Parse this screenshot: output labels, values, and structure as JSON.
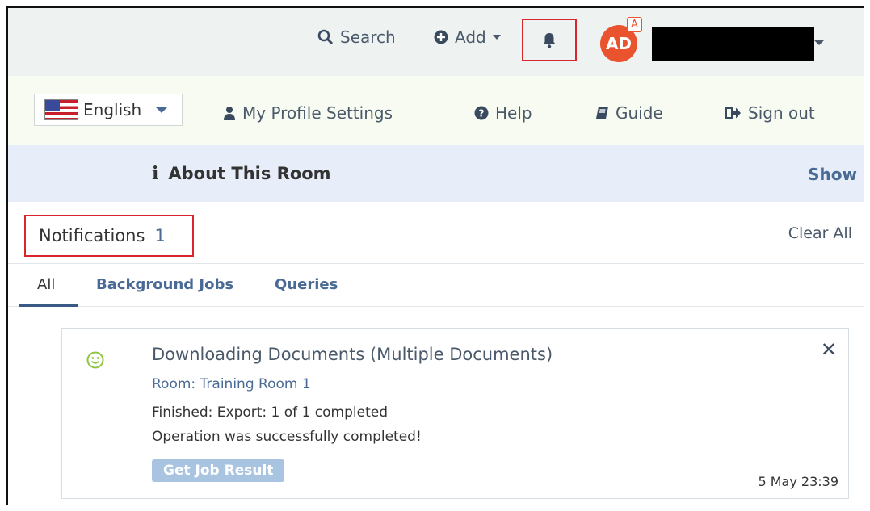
{
  "topbar": {
    "search_label": "Search",
    "add_label": "Add",
    "avatar_initials": "AD",
    "avatar_badge": "A"
  },
  "nav": {
    "language": "English",
    "profile_label": "My Profile Settings",
    "help_label": "Help",
    "guide_label": "Guide",
    "signout_label": "Sign out"
  },
  "about": {
    "title": "About This Room",
    "show_label": "Show"
  },
  "notifications": {
    "title": "Notifications",
    "count": "1",
    "clear_all_label": "Clear All",
    "tabs": [
      "All",
      "Background Jobs",
      "Queries"
    ],
    "items": [
      {
        "title": "Downloading Documents (Multiple Documents)",
        "room": "Room: Training Room 1",
        "line1": "Finished: Export: 1 of 1 completed",
        "line2": "Operation was successfully completed!",
        "button_label": "Get Job Result",
        "timestamp": "5 May 23:39"
      }
    ]
  },
  "colors": {
    "accent_blue": "#4a6a96",
    "highlight_red": "#d9262c",
    "avatar_orange": "#e9532e",
    "success_green": "#8cc63f"
  }
}
